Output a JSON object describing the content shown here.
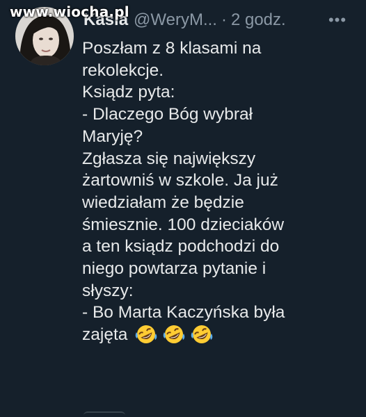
{
  "watermark": {
    "text": "www.wiocha.pl"
  },
  "tweet": {
    "display_name": "Kasia",
    "handle": "@WeryM...",
    "separator": "·",
    "time": "2 godz.",
    "more_label": "•••",
    "avatar_icon": "user-avatar",
    "lines": [
      "Poszłam z 8 klasami na",
      "rekolekcje.",
      "Ksiądz pyta:",
      "- Dlaczego Bóg wybrał",
      "Maryję?",
      "Zgłasza się największy",
      "żartowniś w szkole. Ja już",
      "wiedziałam że będzie",
      "śmiesznie.  100 dzieciaków",
      "a ten ksiądz podchodzi do",
      "niego powtarza pytanie i",
      "słyszy:",
      "- Bo Marta Kaczyńska była"
    ],
    "last_line": "zajęta",
    "emojis": [
      "rolling-on-floor-laughing-emoji",
      "rolling-on-floor-laughing-emoji",
      "rolling-on-floor-laughing-emoji"
    ]
  },
  "colors": {
    "background": "#15202b",
    "text": "#e7e9ea",
    "muted": "#8b98a5"
  }
}
